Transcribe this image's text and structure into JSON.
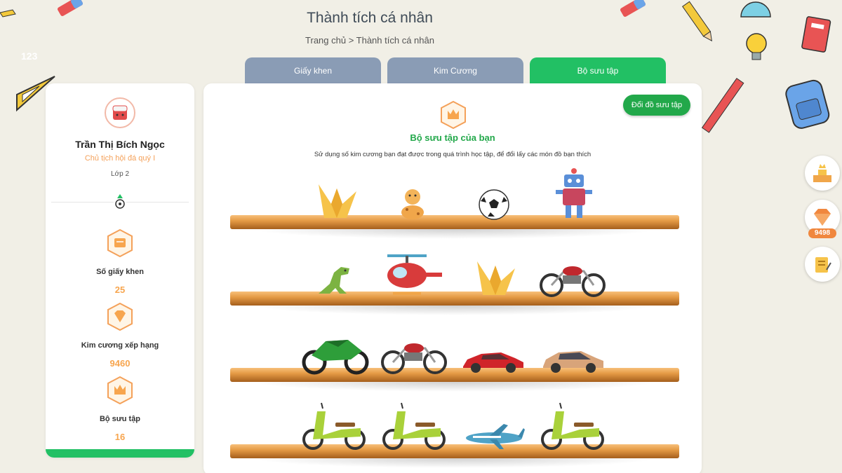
{
  "header": {
    "title": "Thành tích cá nhân",
    "breadcrumb": "Trang chủ > Thành tích cá nhân"
  },
  "tabs": [
    {
      "label": "Giấy khen",
      "active": false
    },
    {
      "label": "Kim Cương",
      "active": false
    },
    {
      "label": "Bộ sưu tập",
      "active": true
    }
  ],
  "profile": {
    "name": "Trần Thị Bích Ngọc",
    "role": "Chủ tịch hội đá quý I",
    "class": "Lớp 2",
    "avatar_icon": "sushi-avatar-icon",
    "stats": [
      {
        "label": "Số giấy khen",
        "value": "25",
        "icon": "certificate-icon"
      },
      {
        "label": "Kim cương xếp hạng",
        "value": "9460",
        "icon": "diamond-icon"
      },
      {
        "label": "Bộ sưu tập",
        "value": "16",
        "icon": "crown-icon"
      }
    ]
  },
  "collection": {
    "exchange_button": "Đổi đồ sưu tập",
    "title": "Bộ sưu tập của bạn",
    "description": "Sử dụng số kim cương bạn đạt được trong quá trình học tập, để đổi lấy các món đồ bạn thích",
    "shelves": [
      [
        "paper-crane-icon",
        "giraffe-toy-icon",
        "soccer-ball-icon",
        "robot-toy-icon"
      ],
      [
        "dinosaur-toy-icon",
        "helicopter-toy-icon",
        "paper-crane-icon",
        "motorcycle-red-icon"
      ],
      [
        "motorcycle-green-icon",
        "motorcycle-red-icon",
        "car-red-icon",
        "car-beige-icon"
      ],
      [
        "scooter-green-icon",
        "scooter-green-icon",
        "airplane-icon",
        "scooter-green-icon"
      ]
    ]
  },
  "side_menu": {
    "diamond_count": "9498"
  },
  "colors": {
    "accent_green": "#22c064",
    "tab_inactive": "#8a9cb5",
    "stat_value": "#f7a54e"
  }
}
